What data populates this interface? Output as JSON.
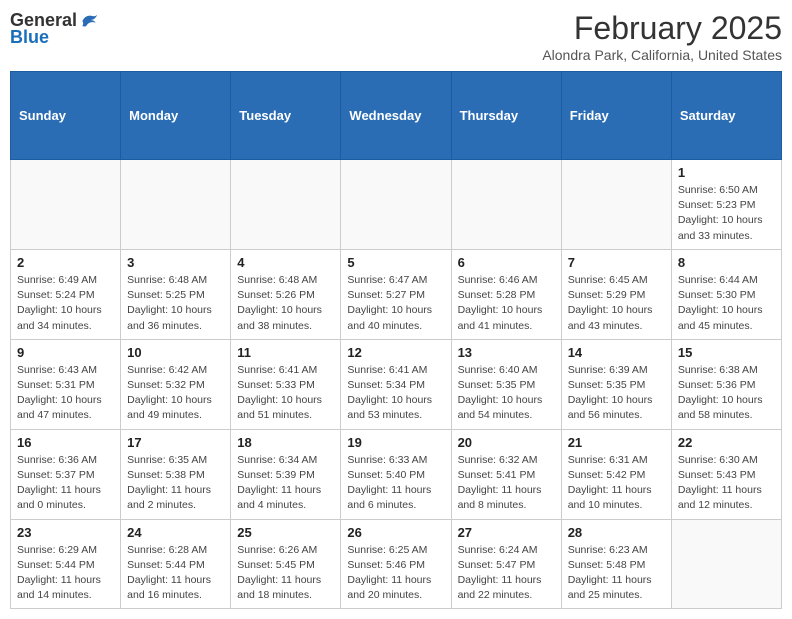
{
  "header": {
    "logo_general": "General",
    "logo_blue": "Blue",
    "month_title": "February 2025",
    "location": "Alondra Park, California, United States"
  },
  "weekdays": [
    "Sunday",
    "Monday",
    "Tuesday",
    "Wednesday",
    "Thursday",
    "Friday",
    "Saturday"
  ],
  "weeks": [
    [
      {
        "day": "",
        "info": ""
      },
      {
        "day": "",
        "info": ""
      },
      {
        "day": "",
        "info": ""
      },
      {
        "day": "",
        "info": ""
      },
      {
        "day": "",
        "info": ""
      },
      {
        "day": "",
        "info": ""
      },
      {
        "day": "1",
        "info": "Sunrise: 6:50 AM\nSunset: 5:23 PM\nDaylight: 10 hours and 33 minutes."
      }
    ],
    [
      {
        "day": "2",
        "info": "Sunrise: 6:49 AM\nSunset: 5:24 PM\nDaylight: 10 hours and 34 minutes."
      },
      {
        "day": "3",
        "info": "Sunrise: 6:48 AM\nSunset: 5:25 PM\nDaylight: 10 hours and 36 minutes."
      },
      {
        "day": "4",
        "info": "Sunrise: 6:48 AM\nSunset: 5:26 PM\nDaylight: 10 hours and 38 minutes."
      },
      {
        "day": "5",
        "info": "Sunrise: 6:47 AM\nSunset: 5:27 PM\nDaylight: 10 hours and 40 minutes."
      },
      {
        "day": "6",
        "info": "Sunrise: 6:46 AM\nSunset: 5:28 PM\nDaylight: 10 hours and 41 minutes."
      },
      {
        "day": "7",
        "info": "Sunrise: 6:45 AM\nSunset: 5:29 PM\nDaylight: 10 hours and 43 minutes."
      },
      {
        "day": "8",
        "info": "Sunrise: 6:44 AM\nSunset: 5:30 PM\nDaylight: 10 hours and 45 minutes."
      }
    ],
    [
      {
        "day": "9",
        "info": "Sunrise: 6:43 AM\nSunset: 5:31 PM\nDaylight: 10 hours and 47 minutes."
      },
      {
        "day": "10",
        "info": "Sunrise: 6:42 AM\nSunset: 5:32 PM\nDaylight: 10 hours and 49 minutes."
      },
      {
        "day": "11",
        "info": "Sunrise: 6:41 AM\nSunset: 5:33 PM\nDaylight: 10 hours and 51 minutes."
      },
      {
        "day": "12",
        "info": "Sunrise: 6:41 AM\nSunset: 5:34 PM\nDaylight: 10 hours and 53 minutes."
      },
      {
        "day": "13",
        "info": "Sunrise: 6:40 AM\nSunset: 5:35 PM\nDaylight: 10 hours and 54 minutes."
      },
      {
        "day": "14",
        "info": "Sunrise: 6:39 AM\nSunset: 5:35 PM\nDaylight: 10 hours and 56 minutes."
      },
      {
        "day": "15",
        "info": "Sunrise: 6:38 AM\nSunset: 5:36 PM\nDaylight: 10 hours and 58 minutes."
      }
    ],
    [
      {
        "day": "16",
        "info": "Sunrise: 6:36 AM\nSunset: 5:37 PM\nDaylight: 11 hours and 0 minutes."
      },
      {
        "day": "17",
        "info": "Sunrise: 6:35 AM\nSunset: 5:38 PM\nDaylight: 11 hours and 2 minutes."
      },
      {
        "day": "18",
        "info": "Sunrise: 6:34 AM\nSunset: 5:39 PM\nDaylight: 11 hours and 4 minutes."
      },
      {
        "day": "19",
        "info": "Sunrise: 6:33 AM\nSunset: 5:40 PM\nDaylight: 11 hours and 6 minutes."
      },
      {
        "day": "20",
        "info": "Sunrise: 6:32 AM\nSunset: 5:41 PM\nDaylight: 11 hours and 8 minutes."
      },
      {
        "day": "21",
        "info": "Sunrise: 6:31 AM\nSunset: 5:42 PM\nDaylight: 11 hours and 10 minutes."
      },
      {
        "day": "22",
        "info": "Sunrise: 6:30 AM\nSunset: 5:43 PM\nDaylight: 11 hours and 12 minutes."
      }
    ],
    [
      {
        "day": "23",
        "info": "Sunrise: 6:29 AM\nSunset: 5:44 PM\nDaylight: 11 hours and 14 minutes."
      },
      {
        "day": "24",
        "info": "Sunrise: 6:28 AM\nSunset: 5:44 PM\nDaylight: 11 hours and 16 minutes."
      },
      {
        "day": "25",
        "info": "Sunrise: 6:26 AM\nSunset: 5:45 PM\nDaylight: 11 hours and 18 minutes."
      },
      {
        "day": "26",
        "info": "Sunrise: 6:25 AM\nSunset: 5:46 PM\nDaylight: 11 hours and 20 minutes."
      },
      {
        "day": "27",
        "info": "Sunrise: 6:24 AM\nSunset: 5:47 PM\nDaylight: 11 hours and 22 minutes."
      },
      {
        "day": "28",
        "info": "Sunrise: 6:23 AM\nSunset: 5:48 PM\nDaylight: 11 hours and 25 minutes."
      },
      {
        "day": "",
        "info": ""
      }
    ]
  ]
}
